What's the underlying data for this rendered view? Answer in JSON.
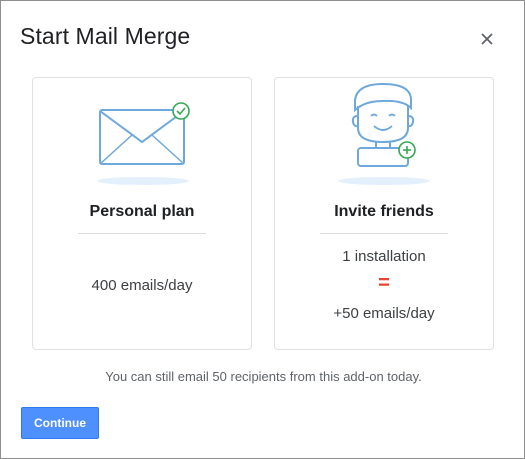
{
  "dialog": {
    "title": "Start Mail Merge",
    "close_icon": "close-icon"
  },
  "cards": {
    "personal": {
      "illustration": "envelope-check-icon",
      "title": "Personal plan",
      "quota": "400 emails/day"
    },
    "invite": {
      "illustration": "person-plus-icon",
      "title": "Invite friends",
      "line1": "1 installation",
      "equals": "=",
      "line2": "+50 emails/day"
    }
  },
  "footer": {
    "note": "You can still email 50 recipients from this add-on today.",
    "continue_label": "Continue"
  },
  "colors": {
    "accent_blue": "#4d90fe",
    "icon_blue": "#6fa8dc",
    "check_green": "#34a853",
    "equals_red": "#ea4335"
  }
}
